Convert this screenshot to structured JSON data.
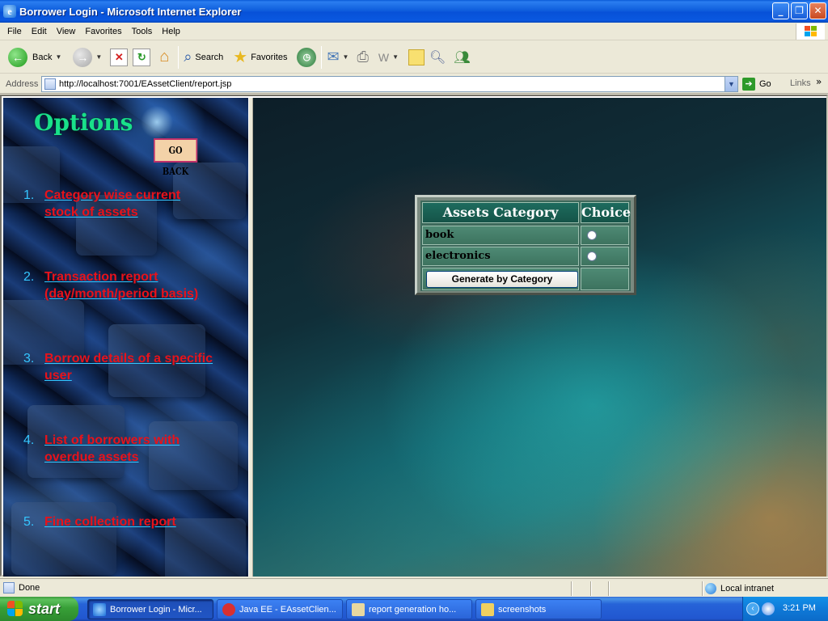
{
  "window": {
    "title": "Borrower Login - Microsoft Internet Explorer",
    "buttons": [
      "_",
      "❐",
      "✕"
    ]
  },
  "menubar": {
    "items": [
      "File",
      "Edit",
      "View",
      "Favorites",
      "Tools",
      "Help"
    ]
  },
  "toolbar": {
    "back_label": "Back",
    "search_label": "Search",
    "favorites_label": "Favorites"
  },
  "address": {
    "label": "Address",
    "url": "http://localhost:7001/EAssetClient/report.jsp",
    "go_label": "Go",
    "links_label": "Links"
  },
  "left_frame": {
    "heading": "Options",
    "go_back_label": "GO BACK",
    "options": [
      {
        "num": "1.",
        "label_line1": "Category wise current",
        "label_line2": "stock of assets"
      },
      {
        "num": "2.",
        "label_line1": "Transaction report",
        "label_line2": "(day/month/period basis)"
      },
      {
        "num": "3.",
        "label_line1": "Borrow details of a specific",
        "label_line2": "user"
      },
      {
        "num": "4.",
        "label_line1": "List of borrowers with",
        "label_line2": "overdue assets"
      },
      {
        "num": "5.",
        "label_line1": "Fine collection report",
        "label_line2": ""
      }
    ]
  },
  "form": {
    "col_category": "Assets Category",
    "col_choice": "Choice",
    "rows": [
      {
        "category": "book",
        "selected": false
      },
      {
        "category": "electronics",
        "selected": false
      }
    ],
    "submit_label": "Generate by Category"
  },
  "statusbar": {
    "status": "Done",
    "zone": "Local intranet"
  },
  "taskbar": {
    "start_label": "start",
    "tasks": [
      {
        "label": "Borrower Login - Micr...",
        "active": true
      },
      {
        "label": "Java EE - EAssetClien...",
        "active": false
      },
      {
        "label": "report generation ho...",
        "active": false
      },
      {
        "label": "screenshots",
        "active": false
      }
    ],
    "clock": "3:21 PM"
  },
  "colors": {
    "options_heading": "#19e08a",
    "link_red": "#e8121a",
    "number_cyan": "#35c6ff",
    "table_header": "#1d6b5e"
  }
}
